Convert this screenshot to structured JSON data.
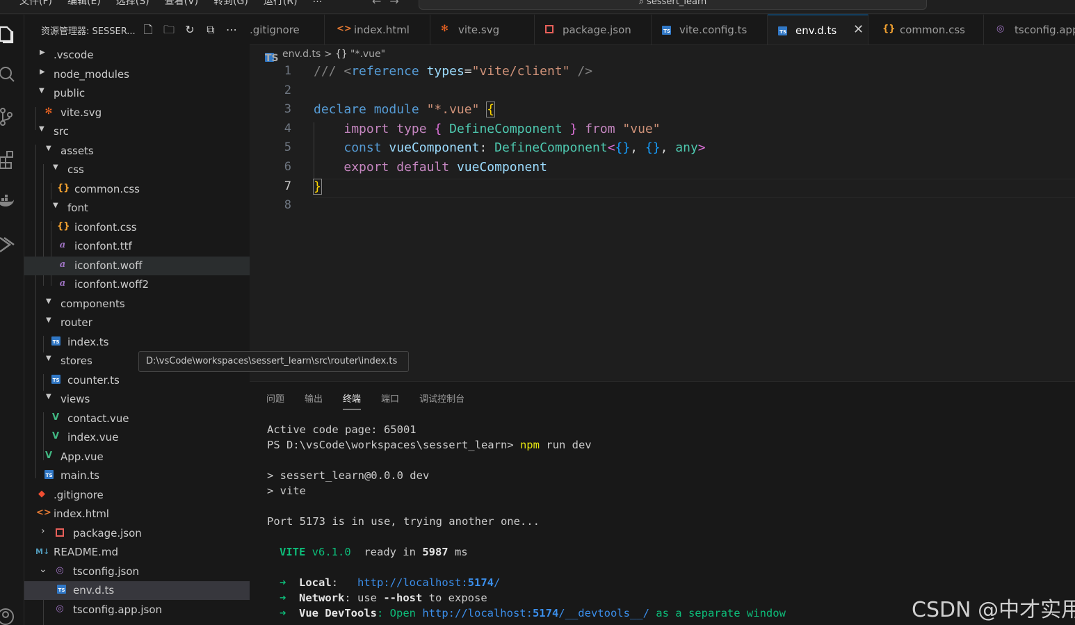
{
  "menubar": {
    "items": [
      "文件(F)",
      "编辑(E)",
      "选择(S)",
      "查看(V)",
      "转到(G)",
      "运行(R)",
      "…"
    ],
    "search_text": "sessert_learn"
  },
  "sidebar": {
    "title": "资源管理器: SESSER...",
    "actions": [
      "new-file-icon",
      "new-folder-icon",
      "refresh-icon",
      "collapse-all-icon",
      "more-icon"
    ],
    "tree": [
      {
        "label": ".vscode"
      },
      {
        "label": "node_modules"
      },
      {
        "label": "public"
      },
      {
        "label": "vite.svg"
      },
      {
        "label": "src"
      },
      {
        "label": "assets"
      },
      {
        "label": "css"
      },
      {
        "label": "common.css"
      },
      {
        "label": "font"
      },
      {
        "label": "iconfont.css"
      },
      {
        "label": "iconfont.ttf"
      },
      {
        "label": "iconfont.woff"
      },
      {
        "label": "iconfont.woff2"
      },
      {
        "label": "components"
      },
      {
        "label": "router"
      },
      {
        "label": "index.ts"
      },
      {
        "label": "stores"
      },
      {
        "label": "counter.ts"
      },
      {
        "label": "views"
      },
      {
        "label": "contact.vue"
      },
      {
        "label": "index.vue"
      },
      {
        "label": "App.vue"
      },
      {
        "label": "main.ts"
      },
      {
        "label": ".gitignore"
      },
      {
        "label": "index.html"
      },
      {
        "label": "package.json"
      },
      {
        "label": "README.md"
      },
      {
        "label": "tsconfig.json"
      },
      {
        "label": "env.d.ts"
      },
      {
        "label": "tsconfig.app.json"
      }
    ]
  },
  "tabs": [
    {
      "label": ".gitignore"
    },
    {
      "label": "index.html"
    },
    {
      "label": "vite.svg"
    },
    {
      "label": "package.json"
    },
    {
      "label": "vite.config.ts"
    },
    {
      "label": "env.d.ts"
    },
    {
      "label": "common.css"
    },
    {
      "label": "tsconfig.app"
    }
  ],
  "tab_close": "✕",
  "breadcrumb": {
    "file": "env.d.ts",
    "sep": ">",
    "symbol_icon": "{}",
    "symbol": "\"*.vue\""
  },
  "editor": {
    "line_numbers": [
      "1",
      "2",
      "3",
      "4",
      "5",
      "6",
      "7",
      "8"
    ],
    "lines": [
      "/// <reference types=\"vite/client\" />",
      "",
      "declare module \"*.vue\" {",
      "    import type { DefineComponent } from \"vue\"",
      "    const vueComponent: DefineComponent<{}, {}, any>",
      "    export default vueComponent",
      "}",
      ""
    ]
  },
  "tooltip": "D:\\vsCode\\workspaces\\sessert_learn\\src\\router\\index.ts",
  "panel": {
    "tabs": [
      "问题",
      "输出",
      "终端",
      "端口",
      "调试控制台"
    ],
    "active_tab": "终端"
  },
  "terminal": {
    "l1": "Active code page: 65001",
    "l2_prompt": "PS D:\\vsCode\\workspaces\\sessert_learn> ",
    "l2_cmd": "npm",
    "l2_args": " run dev",
    "l3": "> sessert_learn@0.0.0 dev",
    "l4": "> vite",
    "l5": "Port 5173 is in use, trying another one...",
    "vite_name": "VITE",
    "vite_ver": " v6.1.0",
    "vite_ready": "  ready in ",
    "vite_ms": "5987",
    "vite_unit": " ms",
    "arrow": "➜",
    "local_label": "Local",
    "local_sep": ":   ",
    "local_url_a": "http://localhost:",
    "local_url_port": "5174",
    "local_url_b": "/",
    "network_label": "Network",
    "network_a": ": use ",
    "network_flag": "--host",
    "network_b": " to expose",
    "devtools_label": "Vue DevTools",
    "devtools_a": ": Open ",
    "devtools_url_a": "http://localhost:",
    "devtools_url_port": "5174",
    "devtools_url_b": "/__devtools__/",
    "devtools_b": " as a separate window"
  },
  "watermark": "CSDN @中才实用"
}
